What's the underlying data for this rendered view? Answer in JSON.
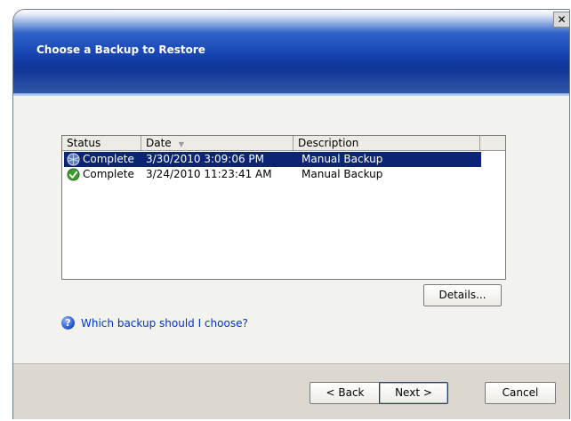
{
  "header": {
    "title": "Choose a Backup to Restore",
    "close_glyph": "✕"
  },
  "list": {
    "columns": [
      "Status",
      "Date",
      "Description",
      ""
    ],
    "sort_indicator": "▼",
    "rows": [
      {
        "status": "Complete",
        "date": "3/30/2010 3:09:06 PM",
        "description": "Manual Backup",
        "selected": true,
        "icon": "backup-globe-icon"
      },
      {
        "status": "Complete",
        "date": "3/24/2010 11:23:41 AM",
        "description": "Manual Backup",
        "selected": false,
        "icon": "check-icon"
      }
    ]
  },
  "buttons": {
    "details": "Details...",
    "back": "< Back",
    "next": "Next >",
    "cancel": "Cancel"
  },
  "help": {
    "link_text": "Which backup should I choose?",
    "icon_glyph": "?"
  },
  "colors": {
    "selection": "#0b2574",
    "link": "#0033cc",
    "header_blue": "#1a48b6"
  }
}
